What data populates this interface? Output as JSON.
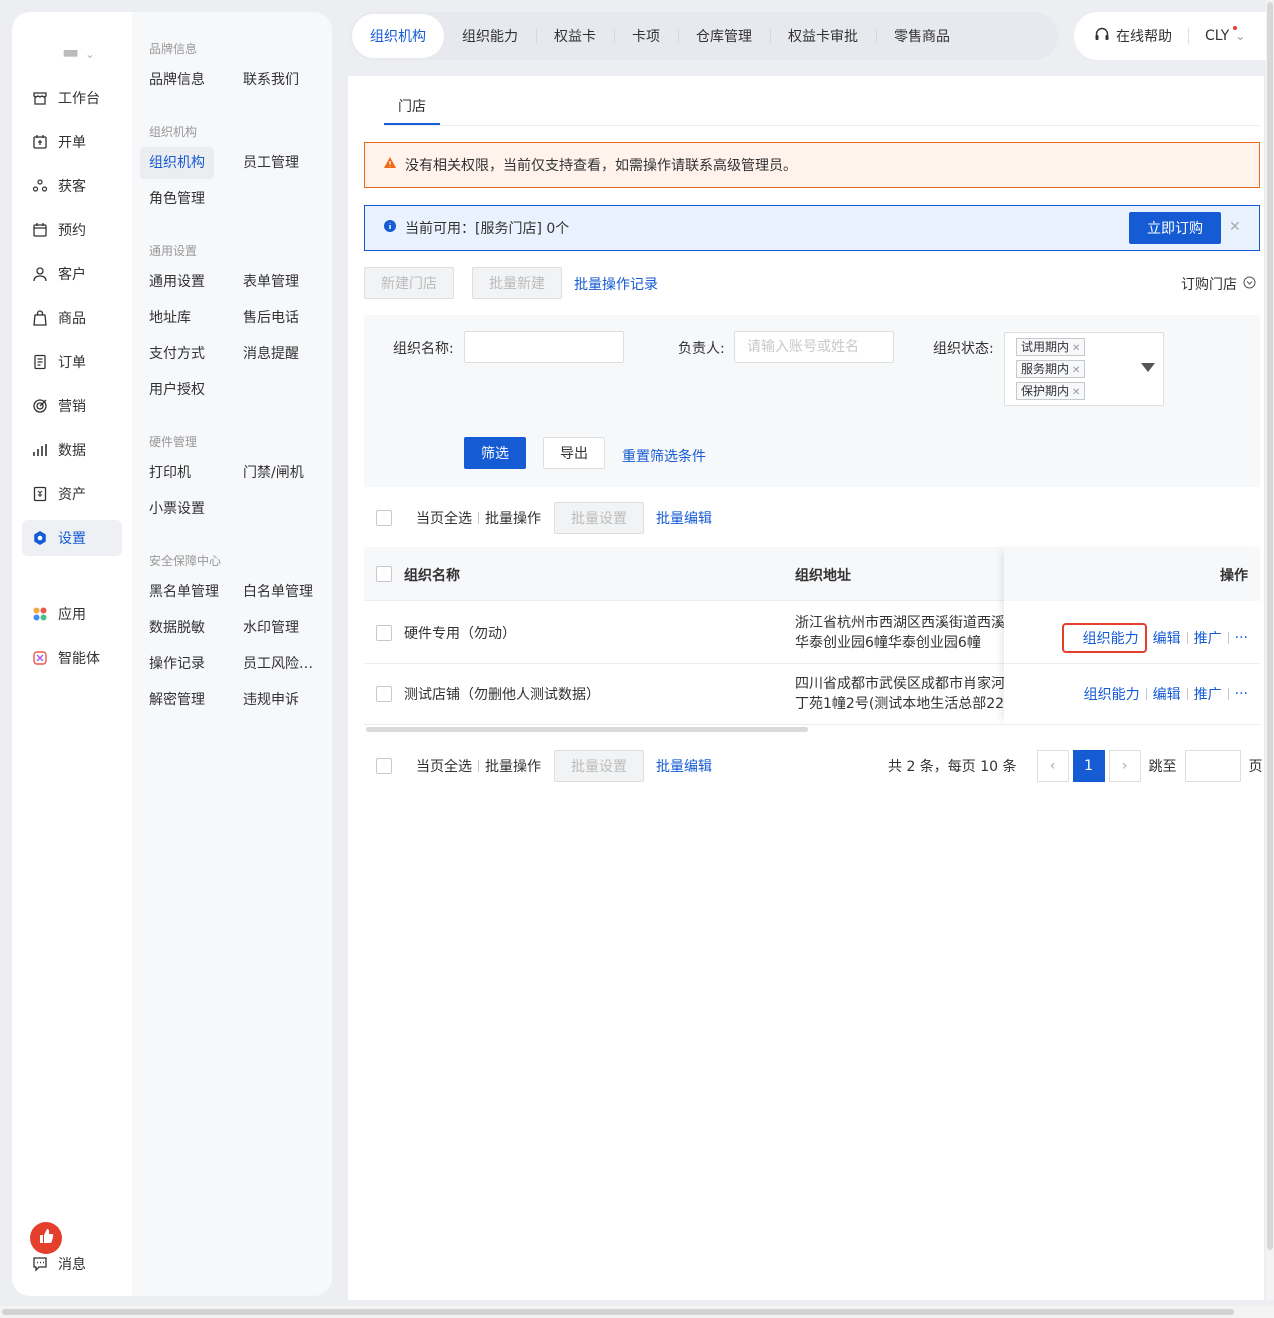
{
  "colors": {
    "brand": "#155bd4",
    "warn": "#ed6a18",
    "danger": "#e43e2c"
  },
  "nav": {
    "items": [
      {
        "label": "工作台",
        "icon": "shop-icon"
      },
      {
        "label": "开单",
        "icon": "order-open-icon"
      },
      {
        "label": "获客",
        "icon": "acquire-icon"
      },
      {
        "label": "预约",
        "icon": "calendar-icon"
      },
      {
        "label": "客户",
        "icon": "user-icon"
      },
      {
        "label": "商品",
        "icon": "bag-icon"
      },
      {
        "label": "订单",
        "icon": "document-icon"
      },
      {
        "label": "营销",
        "icon": "target-icon"
      },
      {
        "label": "数据",
        "icon": "bar-chart-icon"
      },
      {
        "label": "资产",
        "icon": "asset-icon"
      },
      {
        "label": "设置",
        "icon": "gear-icon",
        "active": true
      }
    ],
    "apps": [
      {
        "label": "应用",
        "icon": "apps-icon"
      },
      {
        "label": "智能体",
        "icon": "agent-icon"
      }
    ],
    "message": {
      "label": "消息",
      "icon": "message-icon"
    }
  },
  "subnav": {
    "groups": [
      {
        "title": "品牌信息",
        "items": [
          "品牌信息",
          "联系我们"
        ]
      },
      {
        "title": "组织机构",
        "items": [
          "组织机构",
          "员工管理",
          "角色管理"
        ]
      },
      {
        "title": "通用设置",
        "items": [
          "通用设置",
          "表单管理",
          "地址库",
          "售后电话",
          "支付方式",
          "消息提醒",
          "用户授权"
        ]
      },
      {
        "title": "硬件管理",
        "items": [
          "打印机",
          "门禁/闸机",
          "小票设置"
        ]
      },
      {
        "title": "安全保障中心",
        "items": [
          "黑名单管理",
          "白名单管理",
          "数据脱敏",
          "水印管理",
          "操作记录",
          "员工风险…",
          "解密管理",
          "违规申诉"
        ]
      }
    ]
  },
  "top_tabs": [
    "组织机构",
    "组织能力",
    "权益卡",
    "卡项",
    "仓库管理",
    "权益卡审批",
    "零售商品"
  ],
  "top_right": {
    "help": "在线帮助",
    "user": "CLY"
  },
  "page": {
    "tab": "门店",
    "alert_warn": "没有相关权限，当前仅支持查看，如需操作请联系高级管理员。",
    "alert_info": "当前可用：[服务门店] 0个",
    "buy_now": "立即订购",
    "new_store": "新建门店",
    "batch_new": "批量新建",
    "batch_log": "批量操作记录",
    "order_store": "订购门店"
  },
  "filter": {
    "org_name_label": "组织名称:",
    "owner_label": "负责人:",
    "owner_placeholder": "请输入账号或姓名",
    "status_label": "组织状态:",
    "status_tags": [
      "试用期内",
      "服务期内",
      "保护期内"
    ],
    "filter_btn": "筛选",
    "export_btn": "导出",
    "reset": "重置筛选条件"
  },
  "bulk": {
    "select_page": "当页全选",
    "batch_ops": "批量操作",
    "batch_set": "批量设置",
    "batch_edit": "批量编辑"
  },
  "table": {
    "headers": {
      "name": "组织名称",
      "address": "组织地址",
      "actions": "操作"
    },
    "rows": [
      {
        "name": "硬件专用（勿动）",
        "addr1": "浙江省杭州市西湖区西溪街道西溪",
        "addr2": "华泰创业园6幢华泰创业园6幢"
      },
      {
        "name": "测试店铺（勿删他人测试数据）",
        "addr1": "四川省成都市武侯区成都市肖家河",
        "addr2": "丁苑1幢2号(测试本地生活总部22"
      }
    ],
    "actions": {
      "capability": "组织能力",
      "edit": "编辑",
      "promote": "推广",
      "more": "···"
    }
  },
  "pager": {
    "summary": "共 2 条，每页 10 条",
    "current": "1",
    "jump": "跳至",
    "page": "页"
  }
}
